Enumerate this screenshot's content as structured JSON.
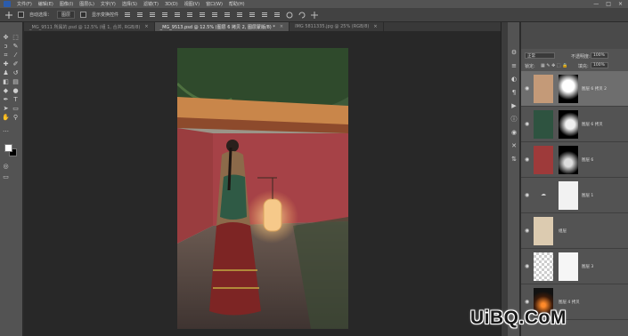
{
  "menubar": {
    "items": [
      "文件(F)",
      "编辑(E)",
      "图像(I)",
      "图层(L)",
      "文字(Y)",
      "选择(S)",
      "滤镜(T)",
      "3D(D)",
      "视图(V)",
      "窗口(W)",
      "帮助(H)"
    ],
    "window_controls": [
      "—",
      "□",
      "×"
    ]
  },
  "options": {
    "auto_select_label": "自动选择：",
    "auto_select_value": "图层",
    "show_transform_label": "显示变换控件"
  },
  "tabs": [
    {
      "label": "_MG_9511 所属的.psd @ 12.5% (组 1, 合并, RGB/8)",
      "close": "×"
    },
    {
      "label": "_MG_9513.psd @ 12.5% (图层 6 拷贝 2, 图层蒙版/8) *",
      "close": "×"
    },
    {
      "label": "IMG 5811335.jpg @ 25% (RGB/8)",
      "close": "×"
    }
  ],
  "layers_panel": {
    "blend_mode": "正常",
    "opacity_label": "不透明度:",
    "opacity_value": "100%",
    "lock_label": "锁定:",
    "fill_label": "填充:",
    "fill_value": "100%",
    "layers": [
      {
        "name": "图层 6 拷贝 2",
        "thumb_color": "#c49a78",
        "selected": true
      },
      {
        "name": "图层 6 拷贝",
        "thumb_color": "#2e5340",
        "selected": false
      },
      {
        "name": "图层 6",
        "thumb_color": "#9e3a3a",
        "selected": false
      },
      {
        "name": "图层 1",
        "thumb_color": "",
        "selected": false
      },
      {
        "name": "组层",
        "thumb_color": "#dccbb0",
        "selected": false
      },
      {
        "name": "图层 3",
        "thumb_color": "",
        "selected": false
      },
      {
        "name": "图层 4 拷贝",
        "thumb_color": "#1a1a1a",
        "selected": false
      }
    ]
  },
  "watermark": "UiBQ.CoM",
  "colors": {
    "accent": "#2b5cad",
    "panel": "#535353",
    "canvas_bg": "#282828",
    "selected_layer": "#6e6e6e"
  }
}
